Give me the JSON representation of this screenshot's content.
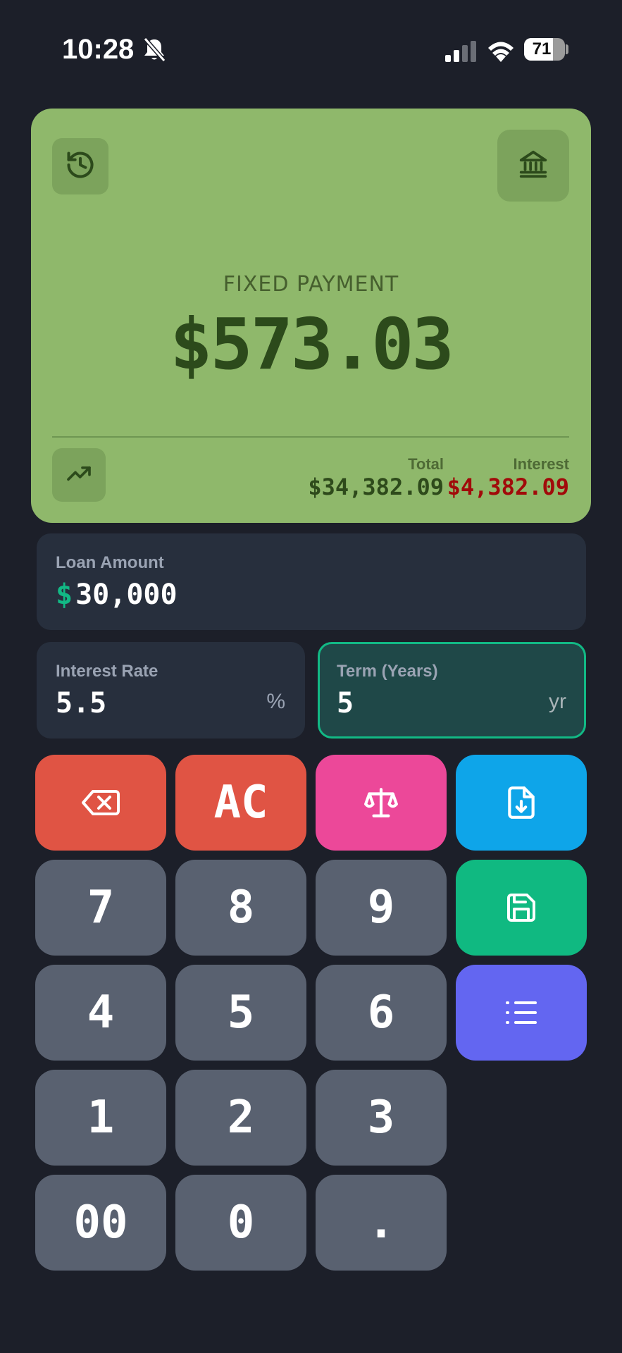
{
  "status_bar": {
    "time": "10:28",
    "battery": "71",
    "battery_level": 0.71,
    "icons": [
      "bell-slash-icon",
      "cellular-signal-icon",
      "wifi-icon",
      "battery-icon"
    ]
  },
  "result": {
    "label": "FIXED PAYMENT",
    "payment": "$573.03",
    "total_label": "Total",
    "total_value": "$34,382.09",
    "interest_label": "Interest",
    "interest_value": "$4,382.09",
    "icons": [
      "history-icon",
      "bank-icon",
      "trending-up-icon"
    ],
    "colors": {
      "card_bg": "#8fb86b",
      "interest": "#a10a0a",
      "payment": "#2c4a1b"
    }
  },
  "fields": {
    "loan": {
      "label": "Loan Amount",
      "currency": "$",
      "value": "30,000"
    },
    "rate": {
      "label": "Interest Rate",
      "value": "5.5",
      "unit": "%"
    },
    "term": {
      "label": "Term (Years)",
      "value": "5",
      "unit": "yr",
      "active": true
    }
  },
  "keypad": {
    "clear": "AC",
    "digits": {
      "seven": "7",
      "eight": "8",
      "nine": "9",
      "four": "4",
      "five": "5",
      "six": "6",
      "one": "1",
      "two": "2",
      "three": "3",
      "double_zero": "00",
      "zero": "0",
      "decimal": "."
    },
    "icons": [
      "backspace-icon",
      "scale-icon",
      "file-download-icon",
      "save-icon",
      "list-icon"
    ],
    "colors": {
      "red": "#e05444",
      "pink": "#ec4899",
      "blue": "#0ea5e9",
      "green": "#10b981",
      "indigo": "#6366f1",
      "digit": "#596170"
    }
  }
}
